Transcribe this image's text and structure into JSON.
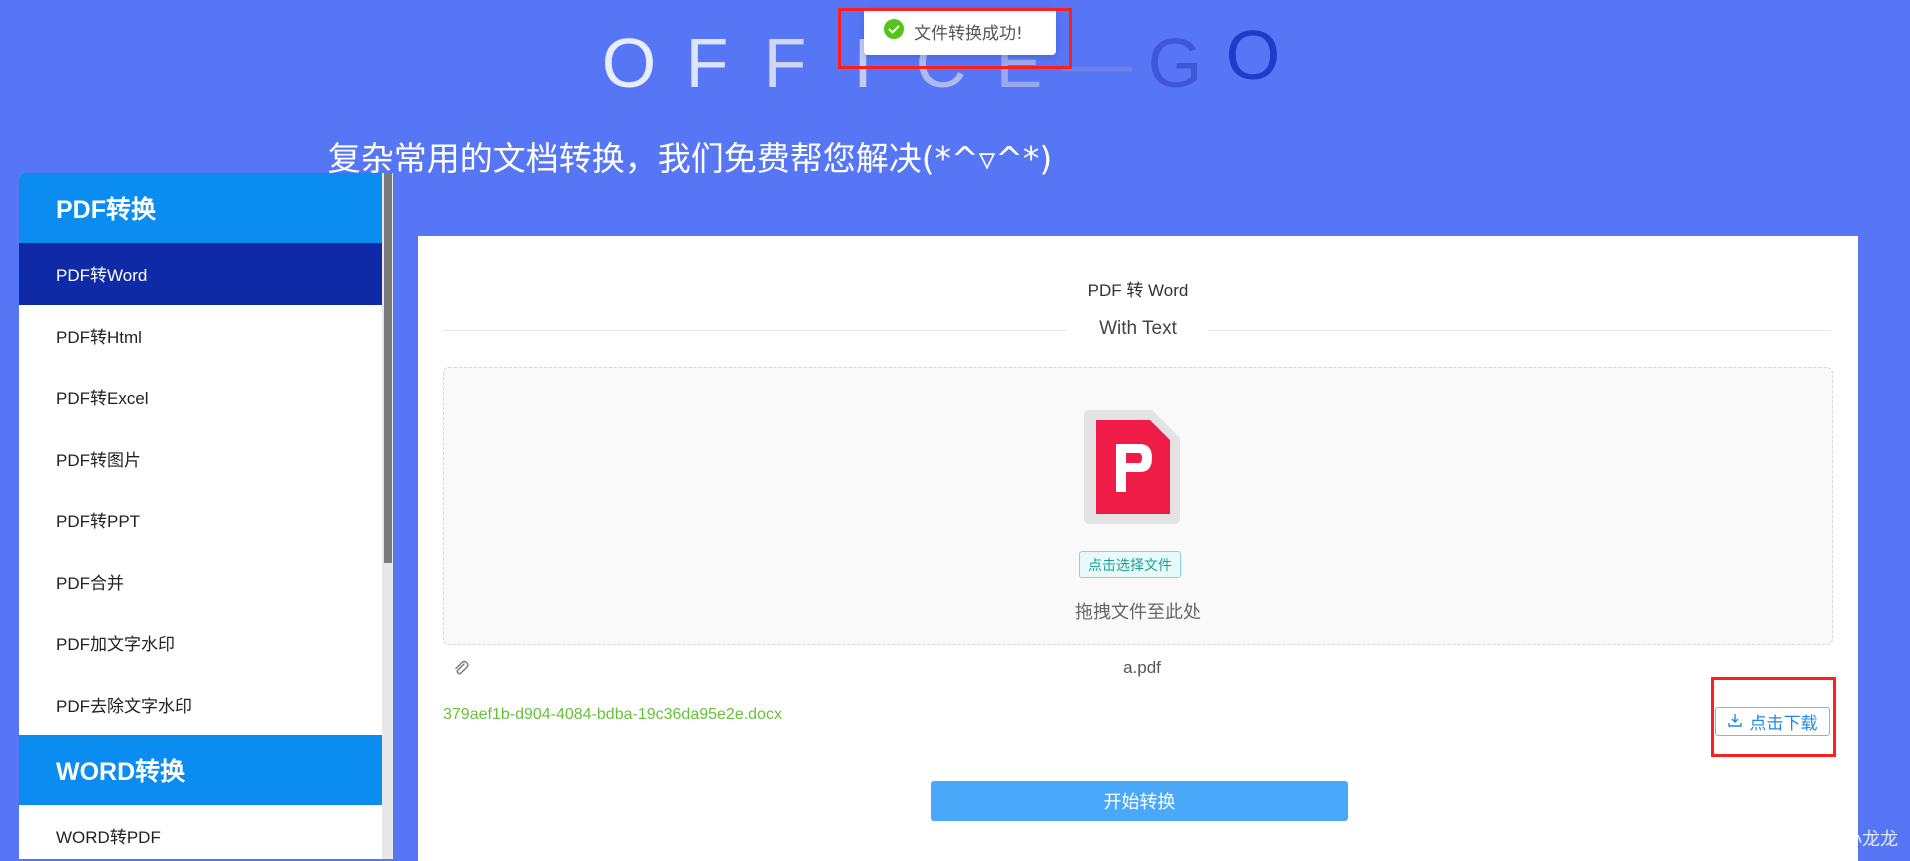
{
  "header": {
    "logo_letters": [
      {
        "ch": "O",
        "color": "#e9edfb"
      },
      {
        "ch": "F",
        "color": "#dde3f8"
      },
      {
        "ch": "F",
        "color": "#cfd7f5"
      },
      {
        "ch": "I",
        "color": "#c3ccf2"
      },
      {
        "ch": "C",
        "color": "#aeb9ef"
      },
      {
        "ch": "E",
        "color": "#9aa8ec"
      },
      {
        "ch": "—",
        "color": "#6f80e6"
      },
      {
        "ch": "G",
        "color": "#3f56d6"
      },
      {
        "ch": "O",
        "color": "#1f3bc8"
      }
    ],
    "subtitle": "复杂常用的文档转换，我们免费帮您解决(*^▿^*)"
  },
  "sidebar": {
    "groups": [
      {
        "title": "PDF转换",
        "items": [
          "PDF转Word",
          "PDF转Html",
          "PDF转Excel",
          "PDF转图片",
          "PDF转PPT",
          "PDF合并",
          "PDF加文字水印",
          "PDF去除文字水印"
        ],
        "active_index": 0
      },
      {
        "title": "WORD转换",
        "items": [
          "WORD转PDF"
        ],
        "active_index": -1
      }
    ]
  },
  "panel": {
    "title": "PDF 转 Word",
    "divider_text": "With Text",
    "upload": {
      "pick_button": "点击选择文件",
      "drag_hint": "拖拽文件至此处"
    },
    "selected_file": "a.pdf",
    "result_file": "379aef1b-d904-4084-bdba-19c36da95e2e.docx",
    "download_button": "点击下载",
    "start_button": "开始转换"
  },
  "toast": {
    "message": "文件转换成功!"
  },
  "watermark": "CSDN @盖世英雄~小龙龙",
  "colors": {
    "background": "#5676f6",
    "sidebar_group": "#0b8cf0",
    "sidebar_active": "#0f2aa6",
    "success": "#67c23a",
    "primary_button": "#4aa8fb",
    "highlight": "#ff1e1e"
  }
}
